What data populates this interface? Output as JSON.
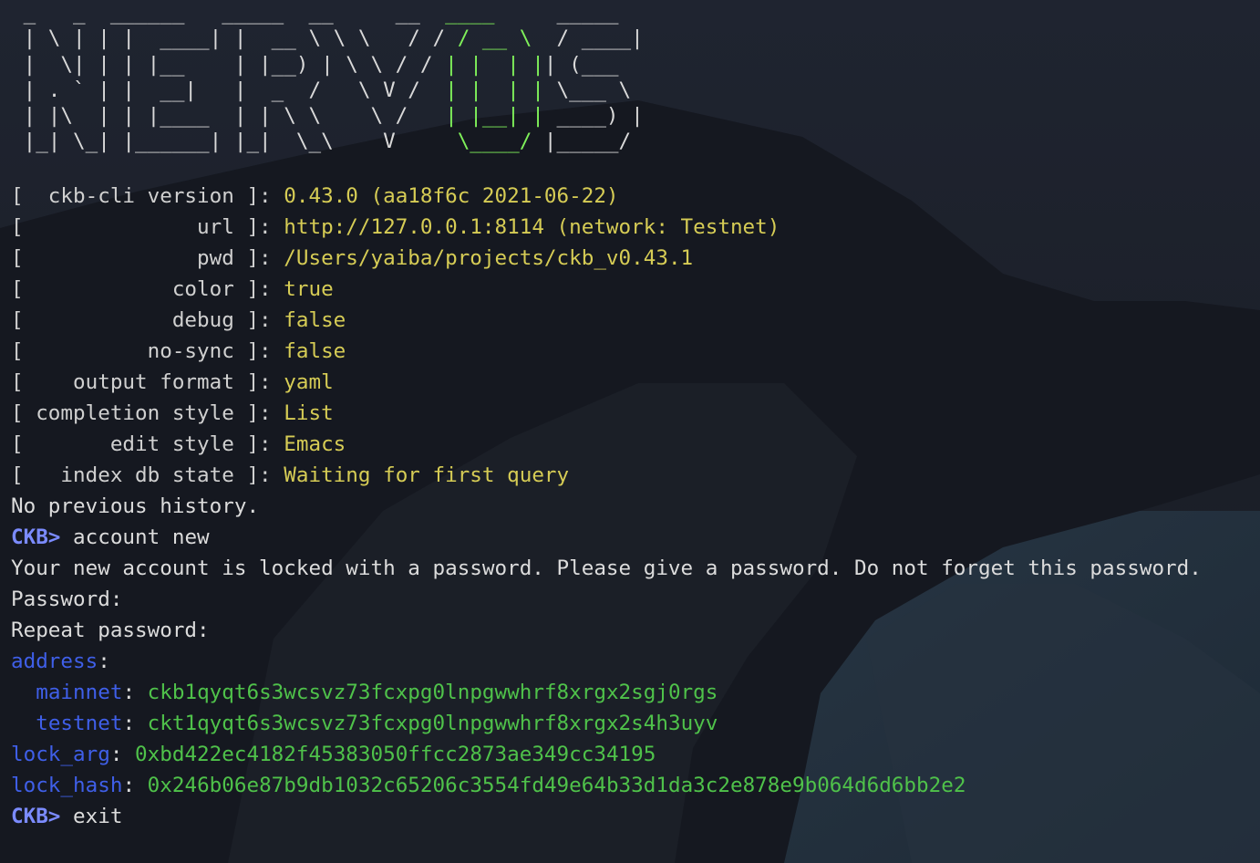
{
  "banner": {
    "lines": [
      [
        " _   _  ______   _____  __     __ ",
        " ____  ",
        "   _____ "
      ],
      [
        " | \\ | | |  ____| |  __ \\ \\ \\   / / ",
        "/ __ \\ ",
        " / ____|"
      ],
      [
        " |  \\| | | |__    | |__) | \\ \\ / / ",
        "| |  | |",
        "| (___  "
      ],
      [
        " | . ` | |  __|   |  _  /   \\ V /  ",
        "| |  | |",
        " \\___ \\ "
      ],
      [
        " | |\\  | | |____  | | \\ \\    \\ /   ",
        "| |__| |",
        " ____) |"
      ],
      [
        " |_| \\_| |______| |_|  \\_\\    V    ",
        " \\____/ ",
        "|_____/ "
      ]
    ]
  },
  "config": [
    {
      "key": "[  ckb-cli version ]: ",
      "value": "0.43.0 (aa18f6c 2021-06-22)"
    },
    {
      "key": "[              url ]: ",
      "value": "http://127.0.0.1:8114 (network: Testnet)"
    },
    {
      "key": "[              pwd ]: ",
      "value": "/Users/yaiba/projects/ckb_v0.43.1"
    },
    {
      "key": "[            color ]: ",
      "value": "true"
    },
    {
      "key": "[            debug ]: ",
      "value": "false"
    },
    {
      "key": "[          no-sync ]: ",
      "value": "false"
    },
    {
      "key": "[    output format ]: ",
      "value": "yaml"
    },
    {
      "key": "[ completion style ]: ",
      "value": "List"
    },
    {
      "key": "[       edit style ]: ",
      "value": "Emacs"
    },
    {
      "key": "[   index db state ]: ",
      "value": "Waiting for first query"
    }
  ],
  "history_line": "No previous history.",
  "prompt": "CKB>",
  "command1": " account new",
  "message": "Your new account is locked with a password. Please give a password. Do not forget this password.",
  "password_label": "Password:",
  "repeat_password_label": "Repeat password:",
  "output": {
    "address_key": "address",
    "mainnet_key": "mainnet",
    "mainnet_value": "ckb1qyqt6s3wcsvz73fcxpg0lnpgwwhrf8xrgx2sgj0rgs",
    "testnet_key": "testnet",
    "testnet_value": "ckt1qyqt6s3wcsvz73fcxpg0lnpgwwhrf8xrgx2s4h3uyv",
    "lock_arg_key": "lock_arg",
    "lock_arg_value": "0xbd422ec4182f45383050ffcc2873ae349cc34195",
    "lock_hash_key": "lock_hash",
    "lock_hash_value": "0x246b06e87b9db1032c65206c3554fd49e64b33d1da3c2e878e9b064d6d6bb2e2"
  },
  "command2": " exit",
  "colors": {
    "banner_green": "#7ff05a",
    "value_yellow": "#d6cc55",
    "prompt_blue": "#7b8bff",
    "field_blue": "#3f5fe8",
    "hash_green": "#4fc24a"
  }
}
